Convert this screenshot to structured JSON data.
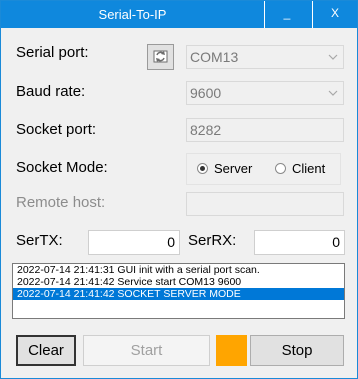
{
  "window": {
    "title": "Serial-To-IP",
    "minimize_label": "_",
    "close_label": "X"
  },
  "form": {
    "serial_port_label": "Serial port:",
    "serial_port_value": "COM13",
    "baud_rate_label": "Baud rate:",
    "baud_rate_value": "9600",
    "socket_port_label": "Socket port:",
    "socket_port_value": "8282",
    "socket_mode_label": "Socket Mode:",
    "mode_server_label": "Server",
    "mode_client_label": "Client",
    "mode_selected": "Server",
    "remote_host_label": "Remote host:",
    "remote_host_value": "",
    "sertx_label": "SerTX:",
    "sertx_value": "0",
    "serrx_label": "SerRX:",
    "serrx_value": "0"
  },
  "log": {
    "lines": [
      "2022-07-14 21:41:31 GUI init with a serial port scan.",
      "2022-07-14 21:41:42 Service start COM13 9600",
      "2022-07-14 21:41:42 SOCKET SERVER MODE"
    ],
    "selected_index": 2
  },
  "buttons": {
    "clear_label": "Clear",
    "start_label": "Start",
    "stop_label": "Stop"
  },
  "colors": {
    "titlebar": "#0f88dd",
    "status_indicator": "#ffa500",
    "selection": "#0078d7"
  },
  "icons": {
    "refresh": "refresh-ports-icon"
  }
}
